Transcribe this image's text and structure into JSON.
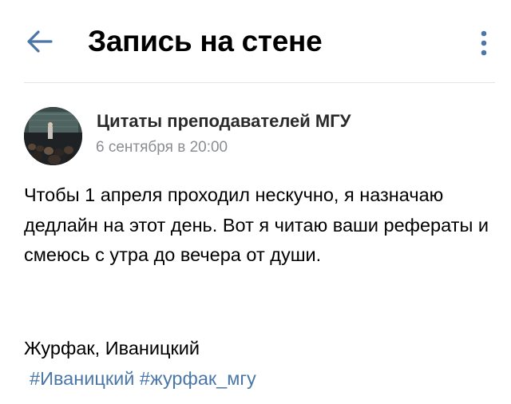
{
  "header": {
    "back_icon": "arrow-left-icon",
    "title": "Запись на стене",
    "more_icon": "vertical-dots-icon"
  },
  "post": {
    "author": "Цитаты преподавателей МГУ",
    "date": "6 сентября в 20:00",
    "avatar_icon": "lecture-hall-photo",
    "text": "Чтобы 1 апреля проходил нескучно, я назначаю дедлайн на этот день. Вот я читаю ваши рефераты и смеюсь с утра до вечера от души.",
    "signature": "Журфак, Иваницкий",
    "tags": [
      "#Иваницкий",
      "#журфак_мгу"
    ]
  },
  "colors": {
    "accent": "#4a76a8",
    "secondary_text": "#8a8d91",
    "divider": "#e3e4e8"
  }
}
